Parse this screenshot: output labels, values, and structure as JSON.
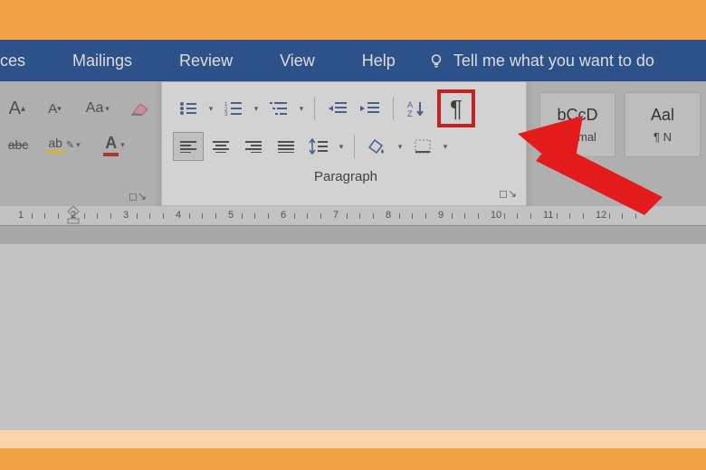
{
  "menu": {
    "tabs": [
      "ces",
      "Mailings",
      "Review",
      "View",
      "Help"
    ],
    "tellme": "Tell me what you want to do"
  },
  "font": {
    "size_increase_label": "A",
    "size_decrease_label": "A",
    "case_label": "Aa",
    "strike_label": "abc",
    "highlight_label": "ab",
    "color_label": "A"
  },
  "paragraph": {
    "label": "Paragraph",
    "sort_label": "A\nZ",
    "pilcrow": "¶"
  },
  "styles": {
    "items": [
      {
        "sample": "bCcD",
        "name": "Normal"
      },
      {
        "sample": "Aal",
        "name": "¶ N"
      }
    ]
  },
  "ruler": {
    "numbers": [
      1,
      2,
      3,
      4,
      5,
      6,
      7,
      8,
      9,
      10,
      11,
      12
    ]
  }
}
